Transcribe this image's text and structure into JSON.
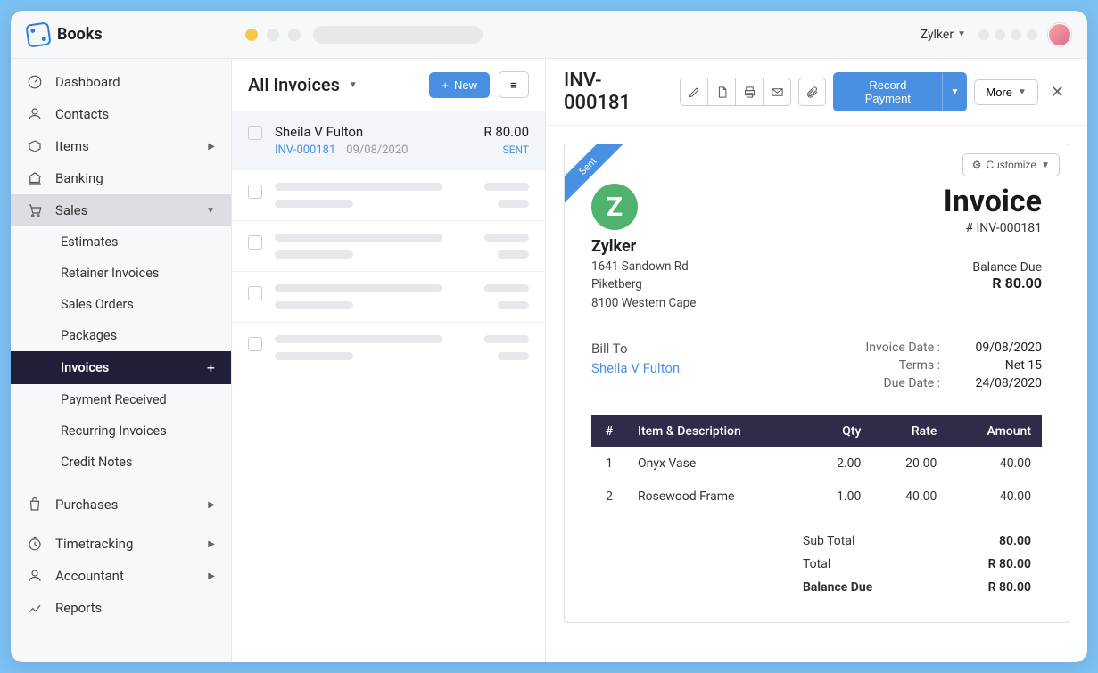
{
  "app_name": "Books",
  "org_name": "Zylker",
  "nav": {
    "dashboard": "Dashboard",
    "contacts": "Contacts",
    "items": "Items",
    "banking": "Banking",
    "sales": "Sales",
    "estimates": "Estimates",
    "retainer": "Retainer Invoices",
    "sales_orders": "Sales Orders",
    "packages": "Packages",
    "invoices": "Invoices",
    "payment_received": "Payment Received",
    "recurring": "Recurring Invoices",
    "credit_notes": "Credit Notes",
    "purchases": "Purchases",
    "timetracking": "Timetracking",
    "accountant": "Accountant",
    "reports": "Reports"
  },
  "list": {
    "title": "All Invoices",
    "new_label": "New",
    "rows": [
      {
        "name": "Sheila V Fulton",
        "no": "INV-000181",
        "date": "09/08/2020",
        "amount": "R 80.00",
        "status": "SENT"
      }
    ]
  },
  "detail": {
    "title": "INV-000181",
    "record_payment": "Record Payment",
    "more": "More",
    "customize": "Customize",
    "ribbon": "Sent",
    "company": {
      "initial": "Z",
      "name": "Zylker",
      "addr1": "1641 Sandown Rd",
      "addr2": "Piketberg",
      "addr3": "8100 Western Cape"
    },
    "invoice_label": "Invoice",
    "invoice_no": "# INV-000181",
    "balance_due_label": "Balance Due",
    "balance_due": "R 80.00",
    "bill_to_label": "Bill To",
    "bill_to": "Sheila V Fulton",
    "meta": {
      "date_lbl": "Invoice Date :",
      "date_val": "09/08/2020",
      "terms_lbl": "Terms :",
      "terms_val": "Net 15",
      "due_lbl": "Due Date :",
      "due_val": "24/08/2020"
    },
    "cols": {
      "num": "#",
      "desc": "Item & Description",
      "qty": "Qty",
      "rate": "Rate",
      "amount": "Amount"
    },
    "items": [
      {
        "n": "1",
        "desc": "Onyx Vase",
        "qty": "2.00",
        "rate": "20.00",
        "amount": "40.00"
      },
      {
        "n": "2",
        "desc": "Rosewood Frame",
        "qty": "1.00",
        "rate": "40.00",
        "amount": "40.00"
      }
    ],
    "totals": {
      "subtotal_lbl": "Sub Total",
      "subtotal": "80.00",
      "total_lbl": "Total",
      "total": "R 80.00",
      "bd_lbl": "Balance Due",
      "bd": "R 80.00"
    }
  }
}
